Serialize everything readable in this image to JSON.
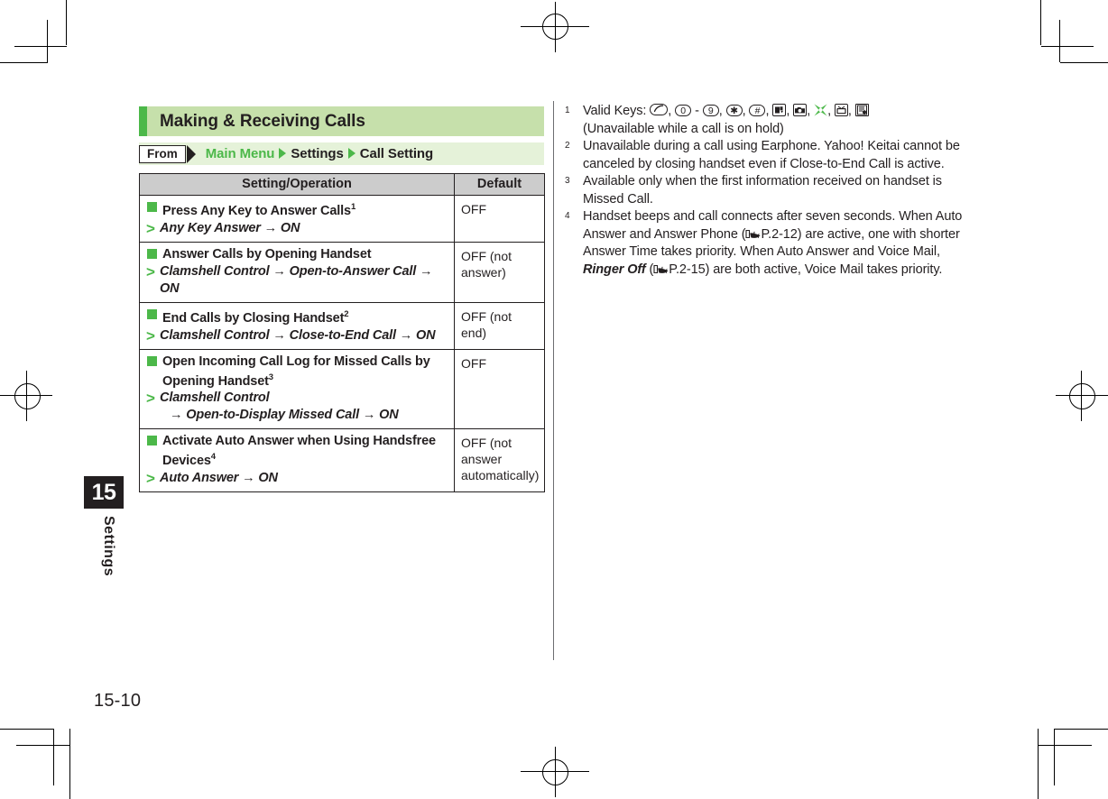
{
  "page": {
    "number": "15-10",
    "chapter_number": "15",
    "chapter_name": "Settings"
  },
  "section": {
    "title": "Making & Receiving Calls",
    "accent_color": "#4cb849",
    "header_bg": "#c6e0ab"
  },
  "breadcrumb": {
    "from_label": "From",
    "items": [
      {
        "label": "Main Menu",
        "color": "#4cb849"
      },
      {
        "label": "Settings",
        "color": "#231f20"
      },
      {
        "label": "Call Setting",
        "color": "#231f20"
      }
    ]
  },
  "table": {
    "headers": [
      "Setting/Operation",
      "Default"
    ],
    "rows": [
      {
        "title": "Press Any Key to Answer Calls",
        "footnote": "1",
        "path": "Any Key Answer → ON",
        "path_line2": "",
        "default": "OFF"
      },
      {
        "title": "Answer Calls by Opening Handset",
        "footnote": "",
        "path": "Clamshell Control → Open-to-Answer Call →",
        "path_line2": "ON",
        "default": "OFF (not answer)"
      },
      {
        "title": "End Calls by Closing Handset",
        "footnote": "2",
        "path": "Clamshell Control → Close-to-End Call → ON",
        "path_line2": "",
        "default": "OFF (not end)"
      },
      {
        "title": "Open Incoming Call Log for Missed Calls by Opening Handset",
        "footnote": "3",
        "path": "Clamshell Control",
        "path_line2": "→ Open-to-Display Missed Call → ON",
        "default": "OFF"
      },
      {
        "title": "Activate Auto Answer when Using Handsfree Devices",
        "footnote": "4",
        "path": "Auto Answer → ON",
        "path_line2": "",
        "default": "OFF (not answer automatically)"
      }
    ]
  },
  "notes": {
    "n1": {
      "num": "1",
      "lead": "Valid Keys:",
      "keys": [
        "call-key",
        "0",
        "9",
        "asterisk",
        "hash",
        "mail-key",
        "camera-key",
        "shortcut-key",
        "tv-key",
        "memo-key"
      ],
      "dash": "-",
      "tail": "(Unavailable while a call is on hold)"
    },
    "n2": {
      "num": "2",
      "text": "Unavailable during a call using Earphone. Yahoo! Keitai cannot be canceled by closing handset even if Close-to-End Call is active."
    },
    "n3": {
      "num": "3",
      "text": "Available only when the first information received on handset is Missed Call."
    },
    "n4": {
      "num": "4",
      "part1": "Handset beeps and call connects after seven seconds. When Auto Answer and Answer Phone (",
      "ref1": "P.2-12",
      "part2": ") are active, one with shorter Answer Time takes priority. When Auto Answer and Voice Mail, ",
      "emphasis": "Ringer Off",
      "part3": " (",
      "ref2": "P.2-15",
      "part4": ") are both active, Voice Mail takes priority."
    }
  }
}
